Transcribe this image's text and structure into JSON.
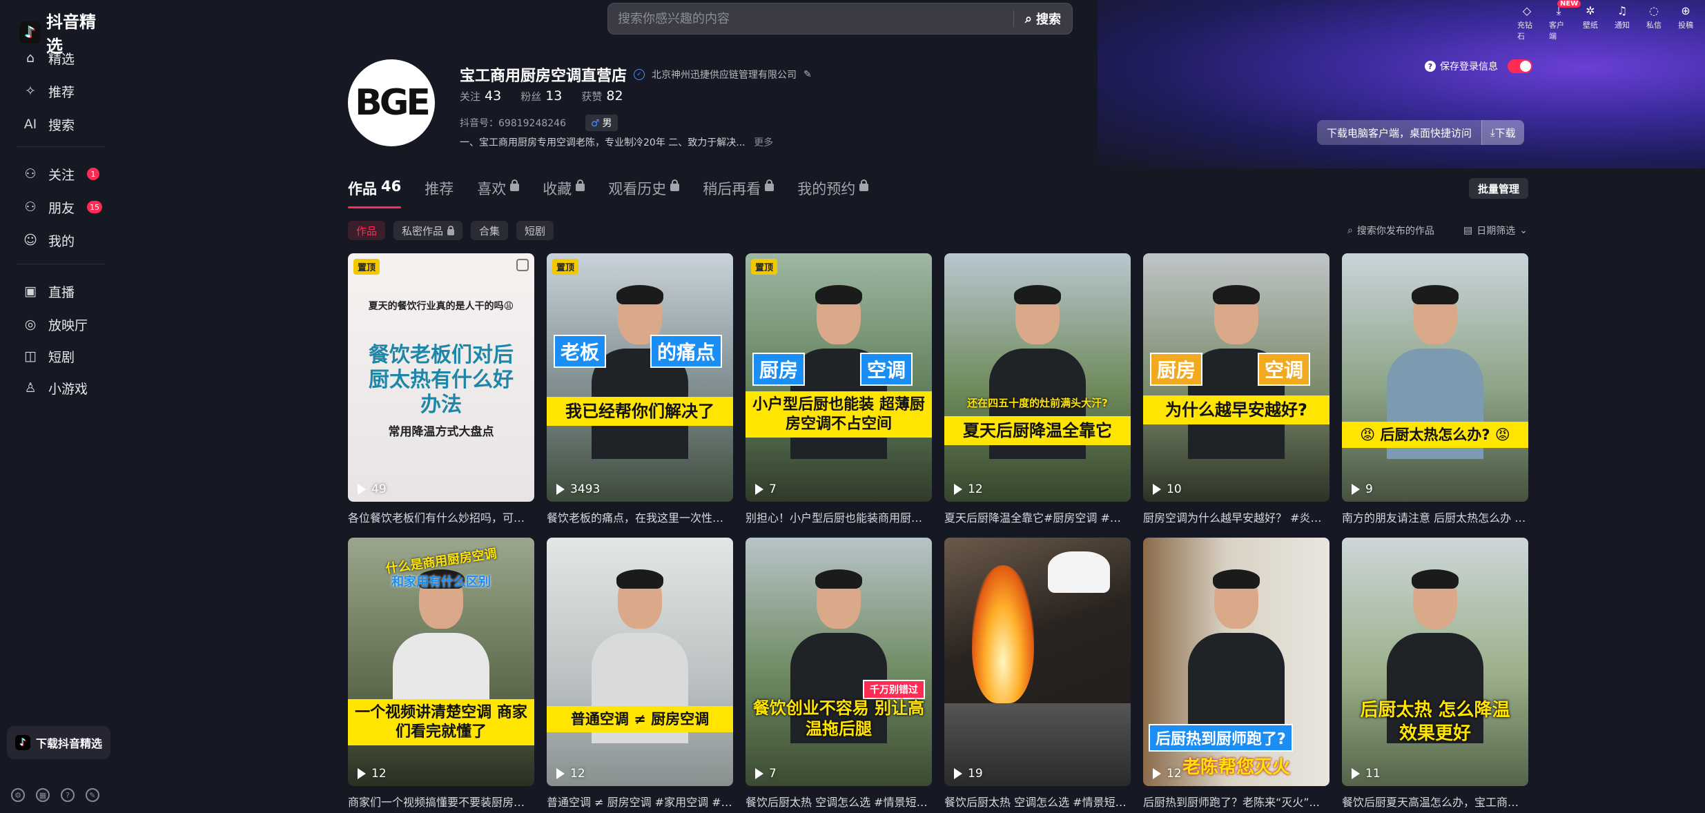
{
  "app": {
    "name": "抖音精选"
  },
  "sidebar": {
    "items": [
      {
        "label": "精选",
        "icon": "home-icon"
      },
      {
        "label": "推荐",
        "icon": "sparkle-icon"
      },
      {
        "label": "搜索",
        "icon": "ai-search-icon",
        "prefix": "AI"
      },
      {
        "label": "关注",
        "icon": "follow-icon",
        "badge": "1"
      },
      {
        "label": "朋友",
        "icon": "friends-icon",
        "badge": "15"
      },
      {
        "label": "我的",
        "icon": "user-icon"
      },
      {
        "label": "直播",
        "icon": "live-icon"
      },
      {
        "label": "放映厅",
        "icon": "theater-icon"
      },
      {
        "label": "短剧",
        "icon": "drama-icon"
      },
      {
        "label": "小游戏",
        "icon": "game-icon"
      }
    ],
    "download_label": "下载抖音精选"
  },
  "header": {
    "search_placeholder": "搜索你感兴趣的内容",
    "search_button": "搜索",
    "top_icons": [
      {
        "label": "充钻石",
        "icon": "diamond-icon"
      },
      {
        "label": "客户端",
        "icon": "download-icon",
        "badge": "NEW"
      },
      {
        "label": "壁纸",
        "icon": "wallpaper-icon"
      },
      {
        "label": "通知",
        "icon": "bell-icon"
      },
      {
        "label": "私信",
        "icon": "message-icon"
      },
      {
        "label": "投稿",
        "icon": "upload-icon"
      }
    ],
    "save_login_label": "保存登录信息",
    "download_pc_text": "下载电脑客户端，桌面快捷访问",
    "download_pc_button": "下载"
  },
  "profile": {
    "avatar_text": "BGE",
    "name": "宝工商用厨房空调直营店",
    "org": "北京神州迅捷供应链管理有限公司",
    "following_label": "关注",
    "following": "43",
    "followers_label": "粉丝",
    "followers": "13",
    "likes_label": "获赞",
    "likes": "82",
    "douyin_id": "抖音号：69819248246",
    "gender": "男",
    "bio": "一、宝工商用厨房专用空调老陈，专业制冷20年 二、致力于解决...",
    "more": "更多"
  },
  "tabs": [
    {
      "label": "作品",
      "count": "46",
      "active": true
    },
    {
      "label": "推荐"
    },
    {
      "label": "喜欢",
      "locked": true
    },
    {
      "label": "收藏",
      "locked": true
    },
    {
      "label": "观看历史",
      "locked": true
    },
    {
      "label": "稍后再看",
      "locked": true
    },
    {
      "label": "我的预约",
      "locked": true
    }
  ],
  "batch_manage": "批量管理",
  "chips": [
    {
      "label": "作品",
      "active": true
    },
    {
      "label": "私密作品",
      "locked": true
    },
    {
      "label": "合集"
    },
    {
      "label": "短剧"
    }
  ],
  "search_works": "搜索你发布的作品",
  "date_filter": "日期筛选",
  "videos": [
    {
      "plays": "49",
      "pinned": "置顶",
      "caption": "各位餐饮老板们有什么妙招吗，可以...",
      "t1": "夏天的餐饮行业真的是人干的吗😩",
      "t2": "餐饮老板们对后厨太热有什么好办法",
      "t3": "常用降温方式大盘点"
    },
    {
      "plays": "3493",
      "pinned": "置顶",
      "caption": "餐饮老板的痛点，在我这里一次性解...",
      "t1": "老板",
      "t2": "的痛点",
      "t3": "我已经帮你们解决了"
    },
    {
      "plays": "7",
      "pinned": "置顶",
      "caption": "别担心！小户型后厨也能装商用厨房...",
      "t1": "厨房",
      "t2": "空调",
      "t3": "小户型后厨也能装 超薄厨房空调不占空间"
    },
    {
      "plays": "12",
      "caption": "夏天后厨降温全靠它#厨房空调 #后...",
      "t1": "还在四五十度的灶前满头大汗?",
      "t2": "夏天后厨降温全靠它"
    },
    {
      "plays": "10",
      "caption": "厨房空调为什么越早安越好？ #炎炎...",
      "t1": "厨房",
      "t2": "空调",
      "t3": "为什么越早安越好?"
    },
    {
      "plays": "9",
      "caption": "南方的朋友请注意 后厨太热怎么办 #...",
      "t1": "😡 后厨太热怎么办? 😡"
    },
    {
      "plays": "12",
      "caption": "商家们一个视频搞懂要不要装厨房空...",
      "t1": "什么是商用厨房空调",
      "t2": "和家用有什么区别",
      "t3": "一个视频讲清楚空调 商家们看完就懂了"
    },
    {
      "plays": "12",
      "caption": "普通空调 ≠ 厨房空调 #家用空调 #后...",
      "t1": "普通空调 ≠ 厨房空调"
    },
    {
      "plays": "7",
      "caption": "餐饮后厨太热 空调怎么选 #情景短剧...",
      "t1": "千万别错过",
      "t2": "餐饮创业不容易 别让高温拖后腿"
    },
    {
      "plays": "19",
      "caption": "餐饮后厨太热 空调怎么选 #情景短剧..."
    },
    {
      "plays": "12",
      "caption": "后厨热到厨师跑了？老陈来“灭火”...",
      "t1": "后厨热到厨师跑了?",
      "t2": "老陈帮您灭火"
    },
    {
      "plays": "11",
      "caption": "餐饮后厨夏天高温怎么办，宝工商用...",
      "t1": "后厨太热 怎么降温效果更好"
    }
  ],
  "colors": {
    "accent": "#fe2c55",
    "bg": "#161823",
    "yellow": "#ffe500"
  }
}
